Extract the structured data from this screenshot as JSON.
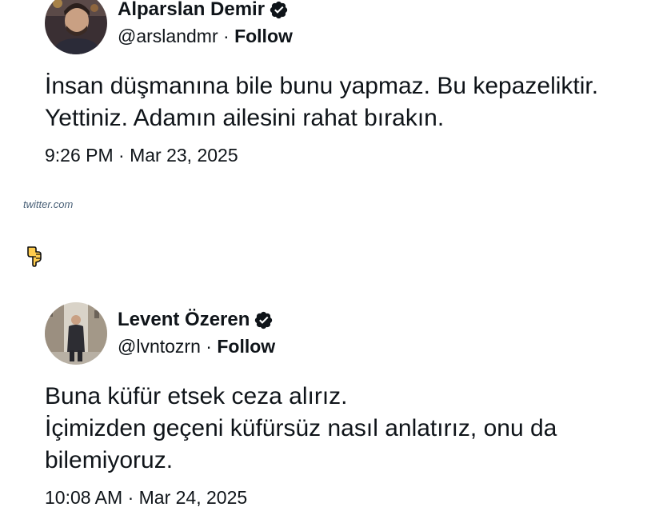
{
  "tweets": [
    {
      "display_name": "Alparslan Demir",
      "handle": "@arslandmr",
      "separator": " · ",
      "follow_label": "Follow",
      "text_lines": [
        "İnsan düşmanına bile bunu yapmaz. Bu kepazeliktir.",
        "Yettiniz. Adamın ailesini rahat bırakın."
      ],
      "timestamp": "9:26 PM · Mar 23, 2025",
      "avatar_icon": "user-avatar-photo",
      "verified_icon": "verified-badge-icon"
    },
    {
      "display_name": "Levent Özeren",
      "handle": "@lvntozrn",
      "separator": " · ",
      "follow_label": "Follow",
      "text_lines": [
        "Buna küfür etsek ceza alırız.",
        "İçimizden geçeni küfürsüz nasıl anlatırız, onu da",
        "bilemiyoruz."
      ],
      "timestamp": "10:08 AM · Mar 24, 2025",
      "avatar_icon": "user-avatar-photo",
      "verified_icon": "verified-badge-icon"
    }
  ],
  "source_label": "twitter.com",
  "pointer_icon": "pointing-down-hand-icon",
  "colors": {
    "text": "#0f1419",
    "verified_badge": "#0f1419",
    "source_text": "#4a6178",
    "pointer_fill": "#ffcc4d"
  }
}
